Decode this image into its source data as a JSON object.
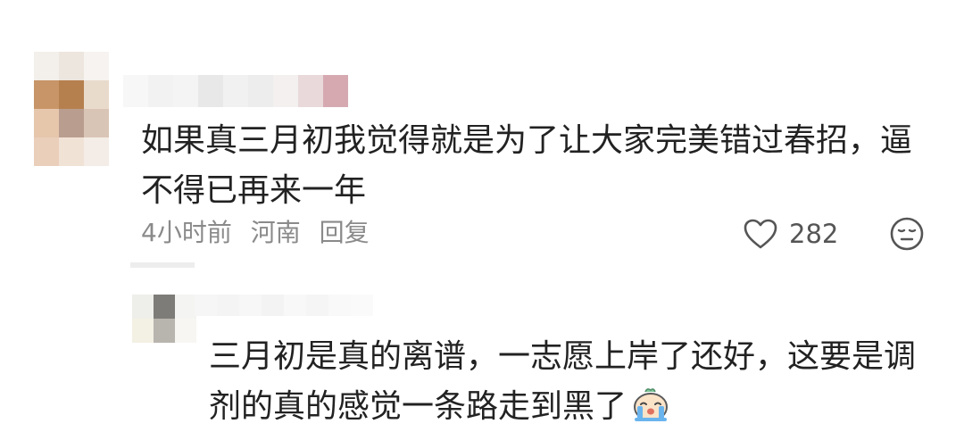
{
  "comments": [
    {
      "text": "如果真三月初我觉得就是为了让大家完美错过春招，逼不得已再来一年",
      "time": "4小时前",
      "location": "河南",
      "reply_label": "回复",
      "likes": "282"
    },
    {
      "text": "三月初是真的离谱，一志愿上岸了还好，这要是调剂的真的感觉一条路走到黑了"
    }
  ],
  "icons": {
    "like": "heart-outline-icon",
    "reaction": "meh-face-icon",
    "reply_emoji": "crying-face-emoji"
  },
  "colors": {
    "text": "#222222",
    "meta": "#8a8a8a",
    "icon": "#555555"
  }
}
